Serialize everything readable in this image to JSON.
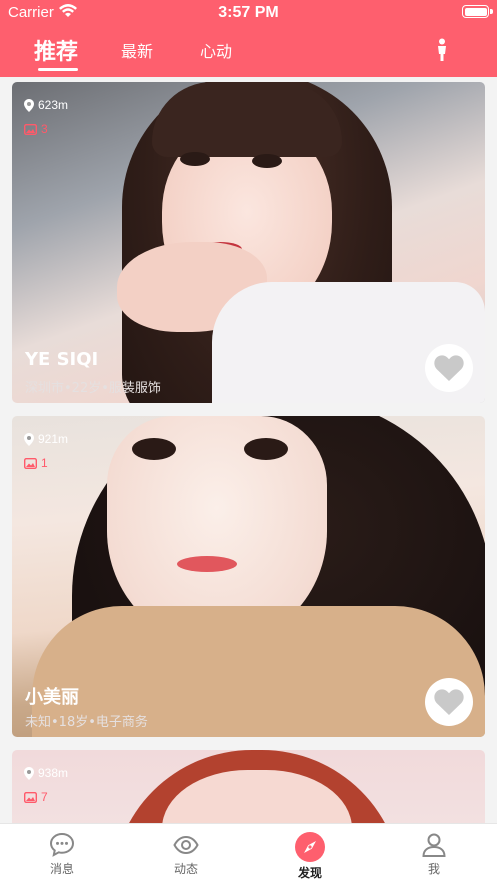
{
  "status_bar": {
    "carrier": "Carrier",
    "time": "3:57 PM"
  },
  "header": {
    "background_color": "#fe5f6e",
    "tabs": [
      {
        "label": "推荐",
        "active": true
      },
      {
        "label": "最新",
        "active": false
      },
      {
        "label": "心动",
        "active": false
      }
    ],
    "filter_icon": "person-icon"
  },
  "cards": [
    {
      "distance": "623m",
      "photo_count": "3",
      "name": "YE SIQI",
      "description": "深圳市•22岁•服装服饰",
      "like_icon": "heart-icon"
    },
    {
      "distance": "921m",
      "photo_count": "1",
      "name": "小美丽",
      "description": "未知•18岁•电子商务",
      "like_icon": "heart-icon"
    },
    {
      "distance": "938m",
      "photo_count": "7"
    }
  ],
  "tabbar": {
    "items": [
      {
        "label": "消息",
        "icon": "chat-bubble-icon",
        "active": false
      },
      {
        "label": "动态",
        "icon": "eye-icon",
        "active": false
      },
      {
        "label": "发现",
        "icon": "compass-icon",
        "active": true
      },
      {
        "label": "我",
        "icon": "user-icon",
        "active": false
      }
    ],
    "accent_color": "#fe5f6e"
  }
}
